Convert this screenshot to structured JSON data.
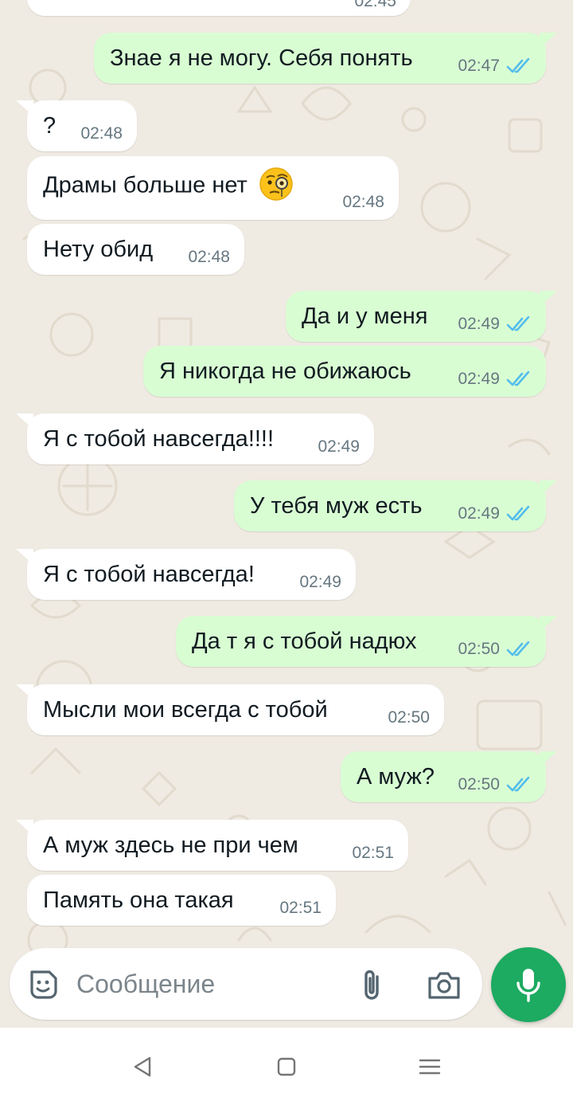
{
  "messages": [
    {
      "text": "Знае я не могу. Себя понять",
      "time": "02:47",
      "direction": "out"
    },
    {
      "text": "?",
      "time": "02:48",
      "direction": "in"
    },
    {
      "text": "Драмы больше нет",
      "time": "02:48",
      "direction": "in",
      "emoji": "face-with-monocle"
    },
    {
      "text": "Нету обид",
      "time": "02:48",
      "direction": "in"
    },
    {
      "text": "Да и у меня",
      "time": "02:49",
      "direction": "out"
    },
    {
      "text": "Я никогда не обижаюсь",
      "time": "02:49",
      "direction": "out"
    },
    {
      "text": "Я с тобой навсегда!!!!",
      "time": "02:49",
      "direction": "in"
    },
    {
      "text": "У тебя муж есть",
      "time": "02:49",
      "direction": "out"
    },
    {
      "text": "Я с тобой навсегда!",
      "time": "02:49",
      "direction": "in"
    },
    {
      "text": "Да т я с тобой надюх",
      "time": "02:50",
      "direction": "out"
    },
    {
      "text": "Мысли мои всегда с тобой",
      "time": "02:50",
      "direction": "in"
    },
    {
      "text": "А муж?",
      "time": "02:50",
      "direction": "out"
    },
    {
      "text": "А муж здесь не при чем",
      "time": "02:51",
      "direction": "in"
    },
    {
      "text": "Память она такая",
      "time": "02:51",
      "direction": "in"
    }
  ],
  "partial_top_time": "02:45",
  "composer": {
    "placeholder": "Сообщение",
    "icons": [
      "sticker-icon",
      "attach-icon",
      "camera-icon"
    ]
  },
  "mic_icon": "mic-icon",
  "navbar": {
    "icons": [
      "back-icon",
      "home-icon",
      "menu-icon"
    ]
  },
  "colors": {
    "outgoing_bubble": "#d9fdd3",
    "incoming_bubble": "#ffffff",
    "chat_background": "#efeae2",
    "read_ticks": "#53bdeb",
    "mic_button": "#1daa61",
    "timestamp": "#667781"
  }
}
